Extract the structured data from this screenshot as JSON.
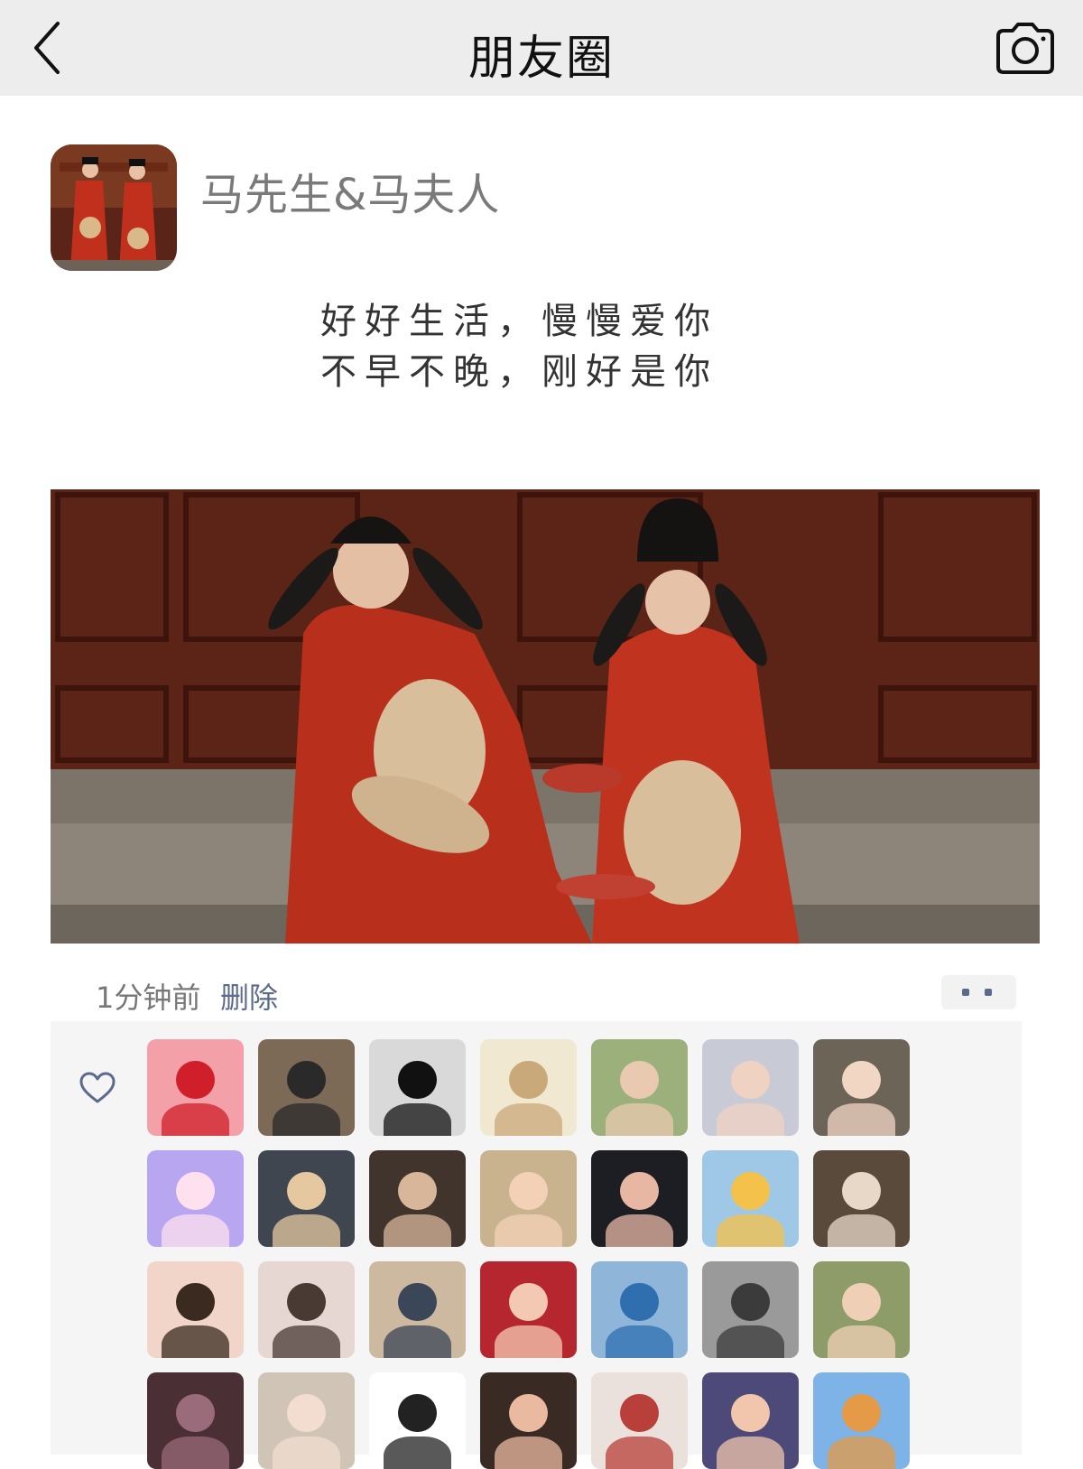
{
  "header": {
    "title": "朋友圈"
  },
  "profile": {
    "name": "马先生&马夫人"
  },
  "post": {
    "lines": [
      "好好生活，慢慢爱你",
      "不早不晚，刚好是你"
    ],
    "time": "1分钟前",
    "delete_label": "删除"
  },
  "icons": {
    "back": "chevron-left-icon",
    "camera": "camera-icon",
    "like": "heart-outline-icon",
    "more": "more-dots-icon"
  },
  "colors": {
    "header_bg": "#ededed",
    "link": "#5b6b8c",
    "panel_bg": "#f5f5f5"
  },
  "likes": {
    "avatars": [
      {
        "name": "pink-bear",
        "bg": "#f3a0a8",
        "fg": "#d01f2a"
      },
      {
        "name": "person-sunglasses",
        "bg": "#7c6a57",
        "fg": "#2a2a2a"
      },
      {
        "name": "black-cat",
        "bg": "#d9d9d9",
        "fg": "#111111"
      },
      {
        "name": "anime-sketch",
        "bg": "#f1e8d2",
        "fg": "#c9a97a"
      },
      {
        "name": "girl-green",
        "bg": "#9bb07a",
        "fg": "#e9c9b0"
      },
      {
        "name": "girl-hoodie",
        "bg": "#c8cbd6",
        "fg": "#f0d2c2"
      },
      {
        "name": "baby-dad",
        "bg": "#6d6458",
        "fg": "#f1d6c4"
      },
      {
        "name": "bunny-heart",
        "bg": "#b9a6f1",
        "fg": "#ffe0ef"
      },
      {
        "name": "dog-hat",
        "bg": "#3f4650",
        "fg": "#e6c8a0"
      },
      {
        "name": "woman-car",
        "bg": "#40342c",
        "fg": "#d8b69a"
      },
      {
        "name": "boy-orange",
        "bg": "#c9b28e",
        "fg": "#f3d1b6"
      },
      {
        "name": "anime-gun",
        "bg": "#1d1d24",
        "fg": "#e8b7a4"
      },
      {
        "name": "adventure-time",
        "bg": "#9fc7e6",
        "fg": "#f4c24a"
      },
      {
        "name": "dance-couple",
        "bg": "#5a4a3c",
        "fg": "#e7d8c8"
      },
      {
        "name": "laughing-girl",
        "bg": "#f0d5c8",
        "fg": "#3a2a20"
      },
      {
        "name": "baby-bow",
        "bg": "#e6d7d2",
        "fg": "#4a3a34"
      },
      {
        "name": "comic-boy",
        "bg": "#cdb8a0",
        "fg": "#3b4658"
      },
      {
        "name": "red-hair-cartoon",
        "bg": "#b6262e",
        "fg": "#f4c9b4"
      },
      {
        "name": "blue-shirt-woman",
        "bg": "#8fb6d9",
        "fg": "#2f6fb0"
      },
      {
        "name": "kitchen-woman",
        "bg": "#9a9a9a",
        "fg": "#3b3b3b"
      },
      {
        "name": "boy-heart",
        "bg": "#8e9c6a",
        "fg": "#efcfb5"
      },
      {
        "name": "dark-figure",
        "bg": "#4a2f35",
        "fg": "#9a6b7a"
      },
      {
        "name": "fluffy-hat-girl",
        "bg": "#cfc4b6",
        "fg": "#f2ddd0"
      },
      {
        "name": "glasses-cartoon",
        "bg": "#ffffff",
        "fg": "#222222"
      },
      {
        "name": "girl-chin",
        "bg": "#3a2a24",
        "fg": "#e9b9a0"
      },
      {
        "name": "baby-red-bow",
        "bg": "#ebe1dc",
        "fg": "#b83f3a"
      },
      {
        "name": "anime-man",
        "bg": "#4d4a7a",
        "fg": "#f1c6ad"
      },
      {
        "name": "shiba-dog",
        "bg": "#7db3e6",
        "fg": "#e49a47"
      }
    ]
  }
}
